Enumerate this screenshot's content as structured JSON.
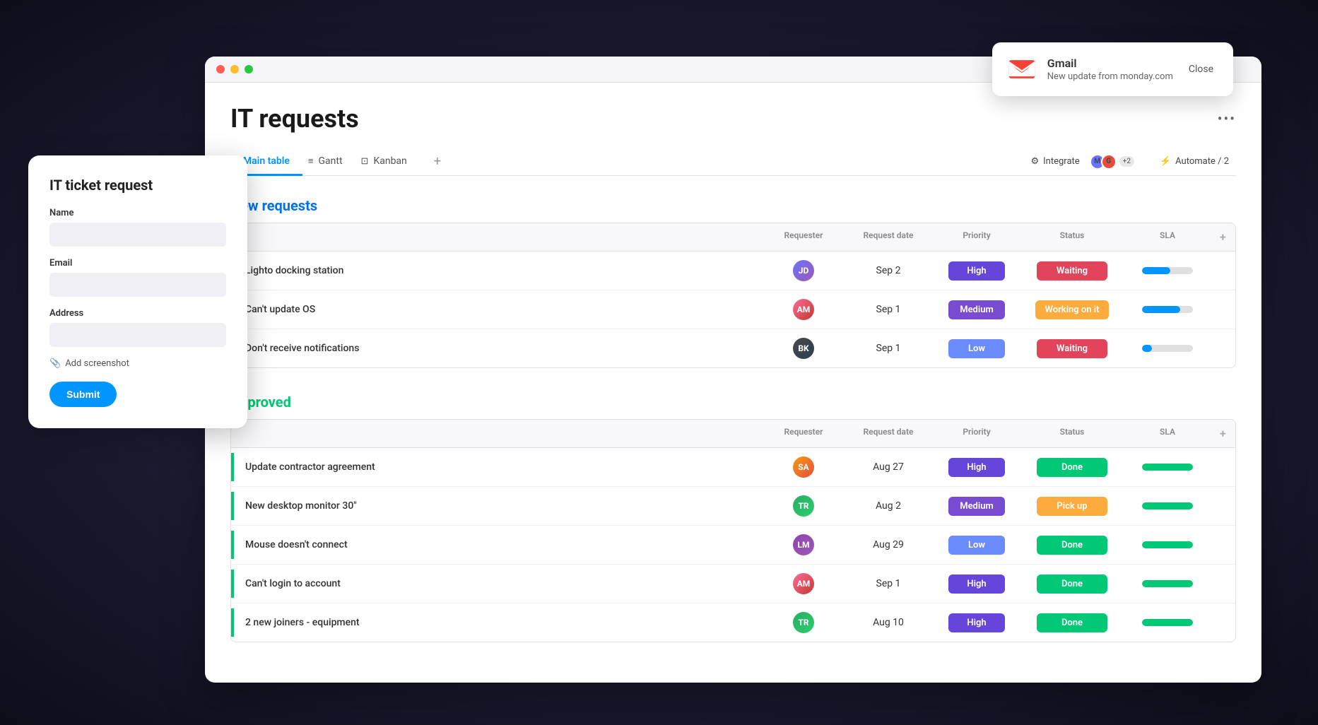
{
  "gmail": {
    "title": "Gmail",
    "subtitle": "New update from monday.com",
    "close_label": "Close"
  },
  "ticket_form": {
    "title": "IT ticket request",
    "name_label": "Name",
    "email_label": "Email",
    "address_label": "Address",
    "screenshot_label": "Add screenshot",
    "submit_label": "Submit"
  },
  "main_window": {
    "page_title": "IT requests",
    "tabs": [
      {
        "label": "Main table",
        "icon": "⊞",
        "active": true
      },
      {
        "label": "Gantt",
        "icon": "≡",
        "active": false
      },
      {
        "label": "Kanban",
        "icon": "⊡",
        "active": false
      }
    ],
    "integrate_label": "Integrate",
    "automate_label": "Automate / 2",
    "integrations_count": "+2"
  },
  "new_requests": {
    "section_label": "New requests",
    "columns": {
      "name": "",
      "requester": "Requester",
      "request_date": "Request date",
      "priority": "Priority",
      "status": "Status",
      "sla": "SLA"
    },
    "rows": [
      {
        "name": "Lighto docking station",
        "requester": "JD",
        "requester_avatar": "av1",
        "request_date": "Sep 2",
        "priority": "High",
        "priority_class": "priority-high",
        "status": "Waiting",
        "status_class": "status-waiting",
        "sla_pct": 55
      },
      {
        "name": "Can't update OS",
        "requester": "AM",
        "requester_avatar": "av2",
        "request_date": "Sep 1",
        "priority": "Medium",
        "priority_class": "priority-medium",
        "status": "Working on it",
        "status_class": "status-working",
        "sla_pct": 75
      },
      {
        "name": "Don't receive notifications",
        "requester": "BK",
        "requester_avatar": "av3",
        "request_date": "Sep 1",
        "priority": "Low",
        "priority_class": "priority-low",
        "status": "Waiting",
        "status_class": "status-waiting",
        "sla_pct": 20
      }
    ]
  },
  "approved": {
    "section_label": "Approved",
    "columns": {
      "name": "",
      "requester": "Requester",
      "request_date": "Request date",
      "priority": "Priority",
      "status": "Status",
      "sla": "SLA"
    },
    "rows": [
      {
        "name": "Update contractor agreement",
        "requester": "SA",
        "requester_avatar": "av4",
        "request_date": "Aug 27",
        "priority": "High",
        "priority_class": "priority-high",
        "status": "Done",
        "status_class": "status-done",
        "sla_pct": 100
      },
      {
        "name": "New desktop monitor 30\"",
        "requester": "TR",
        "requester_avatar": "av5",
        "request_date": "Aug 2",
        "priority": "Medium",
        "priority_class": "priority-medium",
        "status": "Pick up",
        "status_class": "status-pickup",
        "sla_pct": 100
      },
      {
        "name": "Mouse doesn't connect",
        "requester": "LM",
        "requester_avatar": "av6",
        "request_date": "Aug 29",
        "priority": "Low",
        "priority_class": "priority-low",
        "status": "Done",
        "status_class": "status-done",
        "sla_pct": 100
      },
      {
        "name": "Can't login to account",
        "requester": "AM",
        "requester_avatar": "av2",
        "request_date": "Sep 1",
        "priority": "High",
        "priority_class": "priority-high",
        "status": "Done",
        "status_class": "status-done",
        "sla_pct": 100
      },
      {
        "name": "2 new joiners - equipment",
        "requester": "TR",
        "requester_avatar": "av5",
        "request_date": "Aug 10",
        "priority": "High",
        "priority_class": "priority-high",
        "status": "Done",
        "status_class": "status-done",
        "sla_pct": 100
      }
    ]
  }
}
